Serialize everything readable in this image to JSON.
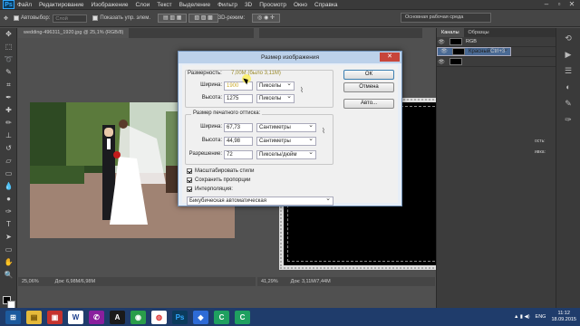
{
  "menubar": {
    "logo": "Ps",
    "items": [
      "Файл",
      "Редактирование",
      "Изображение",
      "Слои",
      "Текст",
      "Выделение",
      "Фильтр",
      "3D",
      "Просмотр",
      "Окно",
      "Справка"
    ]
  },
  "options": {
    "autoselect_label": "Автовыбор:",
    "autoselect_value": "Слой",
    "show_controls_label": "Показать упр. элем.",
    "mode_3d_label": "3D-режим:",
    "workspace": "Основная рабочая среда"
  },
  "doc1": {
    "tab_label": "wedding-496311_1920.jpg @ 25,1% (RGB/8)",
    "zoom": "25,06%",
    "doc_info": "Док: 6,98M/6,98M"
  },
  "doc2": {
    "tab_label": "",
    "zoom": "41,29%",
    "doc_info": "Док: 3,11M/7,44M"
  },
  "channels": {
    "tabs": [
      "Каналы",
      "Образцы"
    ],
    "rows": [
      {
        "name": "RGB",
        "key": "Ctrl+2"
      },
      {
        "name": "Красный",
        "key": "Ctrl+3"
      },
      {
        "name": "",
        "key": "Ctrl+4"
      },
      {
        "name": "",
        "key": "Ctrl+5"
      }
    ]
  },
  "layer_props": [
    "ость:",
    "ивка:"
  ],
  "dialog": {
    "title": "Размер изображения",
    "pixel_dims_label": "Размерность:",
    "pixel_dims_value": "7,00M (было 3,11M)",
    "width_label": "Ширина:",
    "width_value": "1900",
    "width_unit": "Пикселы",
    "height_label": "Высота:",
    "height_value": "1275",
    "height_unit": "Пикселы",
    "print_group_label": "Размер печатного оттиска:",
    "pwidth_label": "Ширина:",
    "pwidth_value": "67,73",
    "pwidth_unit": "Сантиметры",
    "pheight_label": "Высота:",
    "pheight_value": "44,98",
    "pheight_unit": "Сантиметры",
    "res_label": "Разрешение:",
    "res_value": "72",
    "res_unit": "Пикселы/дюйм",
    "scale_styles": "Масштабировать стили",
    "keep_proportions": "Сохранить пропорции",
    "interpolation": "Интерполяция:",
    "interp_value": "Бикубическая автоматическая",
    "ok": "ОК",
    "cancel": "Отмена",
    "auto": "Авто...",
    "close": "✕"
  },
  "taskbar": {
    "lang": "ENG",
    "time": "11:12",
    "date": "18.09.2015"
  },
  "colors": {
    "accent": "#31a8ff",
    "taskbar": "#1f3c6b",
    "dialog_title": "#bcd1ea",
    "close": "#c7453b"
  }
}
